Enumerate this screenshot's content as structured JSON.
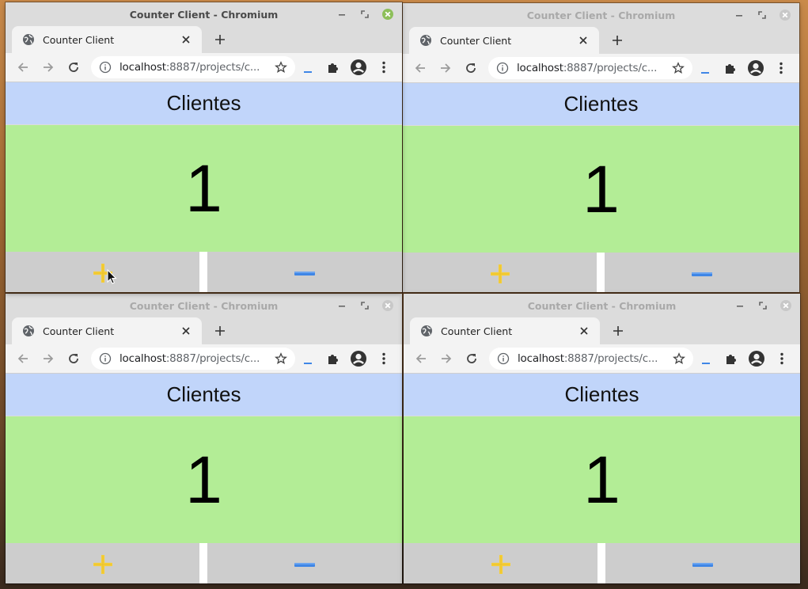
{
  "desktop": {
    "accent_colors": {
      "header_bg": "#c1d5fa",
      "counter_bg": "#b3ed96",
      "button_bg": "#cdcdcd",
      "plus_color": "#f5cf3a",
      "minus_color": "#3f86e6",
      "close_active": "#8dbf5a"
    }
  },
  "windows": [
    {
      "title": "Counter Client - Chromium",
      "active": true,
      "tab_title": "Counter Client",
      "url_host": "localhost",
      "url_rest": ":8887/projects/c...",
      "header": "Clientes",
      "counter_value": "1",
      "plus_icon": "plus-icon",
      "minus_icon": "minus-icon"
    },
    {
      "title": "Counter Client - Chromium",
      "active": false,
      "tab_title": "Counter Client",
      "url_host": "localhost",
      "url_rest": ":8887/projects/c...",
      "header": "Clientes",
      "counter_value": "1",
      "plus_icon": "plus-icon",
      "minus_icon": "minus-icon"
    },
    {
      "title": "Counter Client - Chromium",
      "active": false,
      "tab_title": "Counter Client",
      "url_host": "localhost",
      "url_rest": ":8887/projects/c...",
      "header": "Clientes",
      "counter_value": "1",
      "plus_icon": "plus-icon",
      "minus_icon": "minus-icon"
    },
    {
      "title": "Counter Client - Chromium",
      "active": false,
      "tab_title": "Counter Client",
      "url_host": "localhost",
      "url_rest": ":8887/projects/c...",
      "header": "Clientes",
      "counter_value": "1",
      "plus_icon": "plus-icon",
      "minus_icon": "minus-icon"
    }
  ]
}
